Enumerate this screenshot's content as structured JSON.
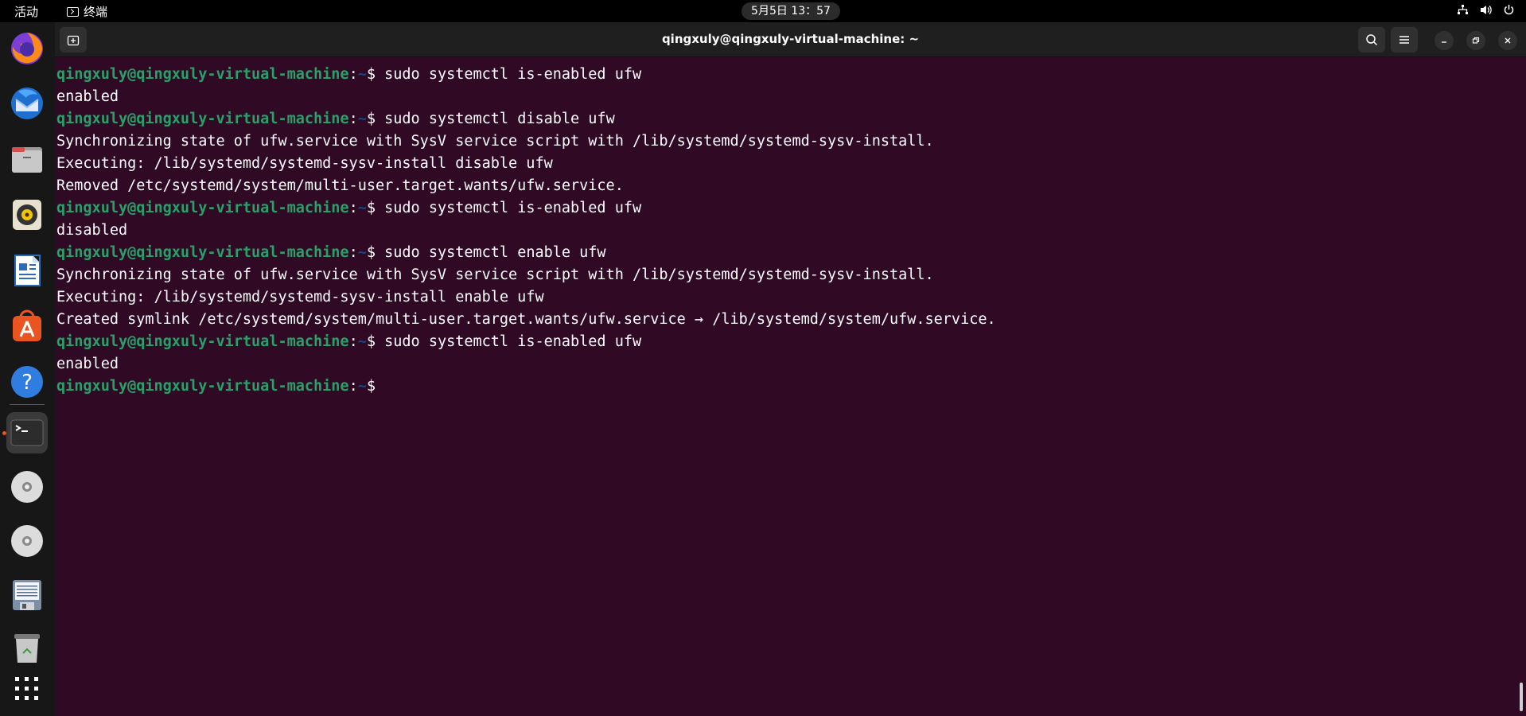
{
  "topbar": {
    "activities": "活动",
    "app_name": "终端",
    "clock": "5月5日  13：57"
  },
  "window": {
    "title": "qingxuly@qingxuly-virtual-machine: ~"
  },
  "prompt": {
    "user_host": "qingxuly@qingxuly-virtual-machine",
    "colon": ":",
    "path": "~",
    "symbol": "$ "
  },
  "terminal": {
    "lines": [
      {
        "type": "cmd",
        "text": "sudo systemctl is-enabled ufw"
      },
      {
        "type": "out",
        "text": "enabled"
      },
      {
        "type": "cmd",
        "text": "sudo systemctl disable ufw"
      },
      {
        "type": "out",
        "text": "Synchronizing state of ufw.service with SysV service script with /lib/systemd/systemd-sysv-install."
      },
      {
        "type": "out",
        "text": "Executing: /lib/systemd/systemd-sysv-install disable ufw"
      },
      {
        "type": "out",
        "text": "Removed /etc/systemd/system/multi-user.target.wants/ufw.service."
      },
      {
        "type": "cmd",
        "text": "sudo systemctl is-enabled ufw"
      },
      {
        "type": "out",
        "text": "disabled"
      },
      {
        "type": "cmd",
        "text": "sudo systemctl enable ufw"
      },
      {
        "type": "out",
        "text": "Synchronizing state of ufw.service with SysV service script with /lib/systemd/systemd-sysv-install."
      },
      {
        "type": "out",
        "text": "Executing: /lib/systemd/systemd-sysv-install enable ufw"
      },
      {
        "type": "out",
        "text": "Created symlink /etc/systemd/system/multi-user.target.wants/ufw.service → /lib/systemd/system/ufw.service."
      },
      {
        "type": "cmd",
        "text": "sudo systemctl is-enabled ufw"
      },
      {
        "type": "out",
        "text": "enabled"
      },
      {
        "type": "cmd",
        "text": ""
      }
    ]
  },
  "dock": {
    "items": [
      {
        "name": "firefox-icon"
      },
      {
        "name": "thunderbird-icon"
      },
      {
        "name": "files-icon"
      },
      {
        "name": "rhythmbox-icon"
      },
      {
        "name": "libreoffice-writer-icon"
      },
      {
        "name": "app-center-icon"
      },
      {
        "name": "help-icon"
      },
      {
        "name": "terminal-icon"
      },
      {
        "name": "disc-icon"
      },
      {
        "name": "disc-icon"
      },
      {
        "name": "text-editor-icon"
      },
      {
        "name": "trash-icon"
      },
      {
        "name": "show-apps-icon"
      }
    ]
  },
  "colors": {
    "terminal_bg": "#300a24",
    "prompt_user": "#26a269",
    "prompt_path": "#12488b",
    "accent": "#e95420"
  }
}
